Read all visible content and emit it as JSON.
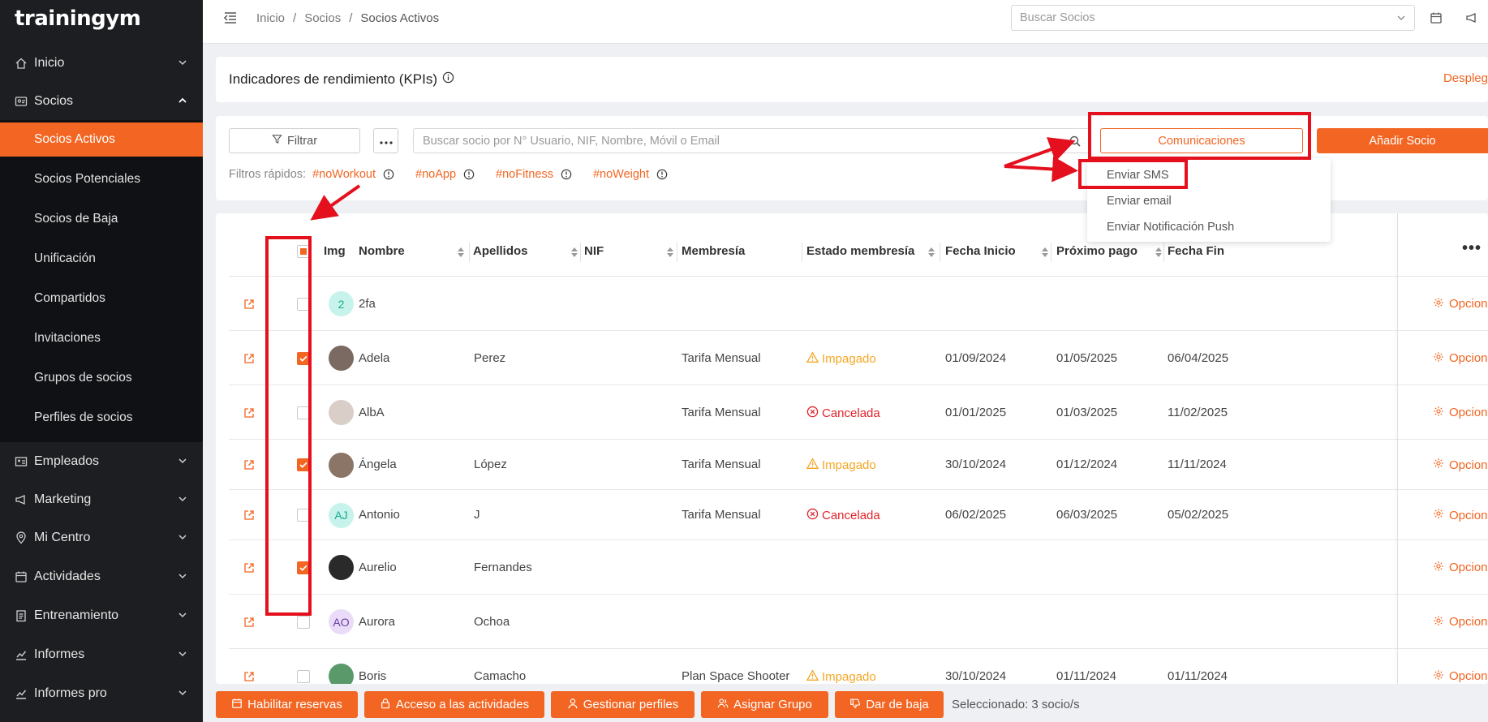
{
  "brand": {
    "logo": "trainingym"
  },
  "sidebar": {
    "items": [
      {
        "label": "Inicio"
      },
      {
        "label": "Socios"
      },
      {
        "label": "Empleados"
      },
      {
        "label": "Marketing"
      },
      {
        "label": "Mi Centro"
      },
      {
        "label": "Actividades"
      },
      {
        "label": "Entrenamiento"
      },
      {
        "label": "Informes"
      },
      {
        "label": "Informes pro"
      }
    ],
    "socios_sub": [
      {
        "label": "Socios Activos",
        "active": true
      },
      {
        "label": "Socios Potenciales"
      },
      {
        "label": "Socios de Baja"
      },
      {
        "label": "Unificación"
      },
      {
        "label": "Compartidos"
      },
      {
        "label": "Invitaciones"
      },
      {
        "label": "Grupos de socios"
      },
      {
        "label": "Perfiles de socios"
      }
    ]
  },
  "topbar": {
    "breadcrumb": [
      "Inicio",
      "/",
      "Socios",
      "/",
      "Socios Activos"
    ],
    "search_placeholder": "Buscar Socios"
  },
  "kpi": {
    "title": "Indicadores de rendimiento (KPIs)",
    "toggle": "Despleg"
  },
  "filters": {
    "filter_button": "Filtrar",
    "search_placeholder": "Buscar socio por N° Usuario, NIF, Nombre, Móvil o Email",
    "comms_button": "Comunicaciones",
    "add_button": "Añadir Socio",
    "quick_label": "Filtros rápidos:",
    "quick": [
      "#noWorkout",
      "#noApp",
      "#noFitness",
      "#noWeight"
    ]
  },
  "comms_menu": [
    "Enviar SMS",
    "Enviar email",
    "Enviar Notificación Push"
  ],
  "table": {
    "headers": [
      "Img",
      "Nombre",
      "Apellidos",
      "NIF",
      "Membresía",
      "Estado membresía",
      "Fecha Inicio",
      "Próximo pago",
      "Fecha Fin"
    ],
    "more": "⋮",
    "options_label": "Opciones",
    "rows": [
      {
        "name": "2fa",
        "surname": "",
        "membership": "",
        "status": "",
        "start": "",
        "next": "",
        "end": "",
        "checked": false,
        "avatar_text": "2",
        "avatar_bg": "#c8f3ec",
        "avatar_fg": "#18a88e"
      },
      {
        "name": "Adela",
        "surname": "Perez",
        "membership": "Tarifa Mensual",
        "status": "Impagado",
        "start": "01/09/2024",
        "next": "01/05/2025",
        "end": "06/04/2025",
        "checked": true,
        "avatar_text": "",
        "avatar_bg": "#7a6a62",
        "avatar_fg": "#fff"
      },
      {
        "name": "AlbA",
        "surname": "",
        "membership": "Tarifa Mensual",
        "status": "Cancelada",
        "start": "01/01/2025",
        "next": "01/03/2025",
        "end": "11/02/2025",
        "checked": false,
        "avatar_text": "",
        "avatar_bg": "#d9cfc8",
        "avatar_fg": "#fff"
      },
      {
        "name": "Ángela",
        "surname": "López",
        "membership": "Tarifa Mensual",
        "status": "Impagado",
        "start": "30/10/2024",
        "next": "01/12/2024",
        "end": "11/11/2024",
        "checked": true,
        "avatar_text": "",
        "avatar_bg": "#8a7566",
        "avatar_fg": "#fff"
      },
      {
        "name": "Antonio",
        "surname": "J",
        "membership": "Tarifa Mensual",
        "status": "Cancelada",
        "start": "06/02/2025",
        "next": "06/03/2025",
        "end": "05/02/2025",
        "checked": false,
        "avatar_text": "AJ",
        "avatar_bg": "#c8f3ec",
        "avatar_fg": "#18a88e"
      },
      {
        "name": "Aurelio",
        "surname": "Fernandes",
        "membership": "",
        "status": "",
        "start": "",
        "next": "",
        "end": "",
        "checked": true,
        "avatar_text": "",
        "avatar_bg": "#2a2a2a",
        "avatar_fg": "#fff"
      },
      {
        "name": "Aurora",
        "surname": "Ochoa",
        "membership": "",
        "status": "",
        "start": "",
        "next": "",
        "end": "",
        "checked": false,
        "avatar_text": "AO",
        "avatar_bg": "#eadcf8",
        "avatar_fg": "#6b3fa0"
      },
      {
        "name": "Boris",
        "surname": "Camacho",
        "membership": "Plan Space Shooter",
        "status": "Impagado",
        "start": "30/10/2024",
        "next": "01/11/2024",
        "end": "01/11/2024",
        "checked": false,
        "avatar_text": "",
        "avatar_bg": "#5a9a6a",
        "avatar_fg": "#fff"
      }
    ]
  },
  "bulk": {
    "buttons": [
      "Habilitar reservas",
      "Acceso a las actividades",
      "Gestionar perfiles",
      "Asignar Grupo",
      "Dar de baja"
    ],
    "selected": "Seleccionado: 3 socio/s"
  },
  "colors": {
    "accent": "#f26522",
    "warning": "#f5a623",
    "danger": "#e0242b",
    "sidebar_bg": "#1d1e21",
    "annotation": "#e4101d"
  }
}
